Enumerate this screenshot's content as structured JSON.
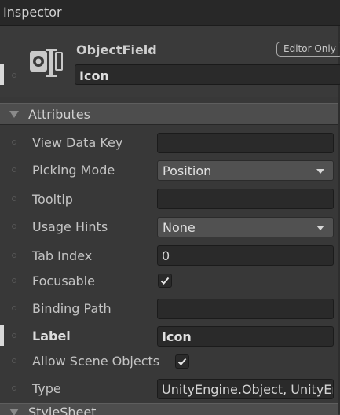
{
  "window": {
    "title": "Inspector"
  },
  "header": {
    "component_name": "ObjectField",
    "badge": "Editor Only",
    "name_value": "Icon",
    "icon": "object-field-icon"
  },
  "attributes": {
    "title": "Attributes",
    "view_data_key": {
      "label": "View Data Key",
      "value": ""
    },
    "picking_mode": {
      "label": "Picking Mode",
      "value": "Position"
    },
    "tooltip": {
      "label": "Tooltip",
      "value": ""
    },
    "usage_hints": {
      "label": "Usage Hints",
      "value": "None"
    },
    "tab_index": {
      "label": "Tab Index",
      "value": "0"
    },
    "focusable": {
      "label": "Focusable",
      "checked": true
    },
    "binding_path": {
      "label": "Binding Path",
      "value": ""
    },
    "label": {
      "label": "Label",
      "value": "Icon"
    },
    "allow_scene_objects": {
      "label": "Allow Scene Objects",
      "checked": true
    },
    "type": {
      "label": "Type",
      "value": "UnityEngine.Object, UnityEngine.CoreModule"
    }
  },
  "stylesheet": {
    "title": "StyleSheet"
  },
  "colors": {
    "background": "#383838",
    "field": "#2a2a2a",
    "foldout": "#4d4d4d"
  }
}
